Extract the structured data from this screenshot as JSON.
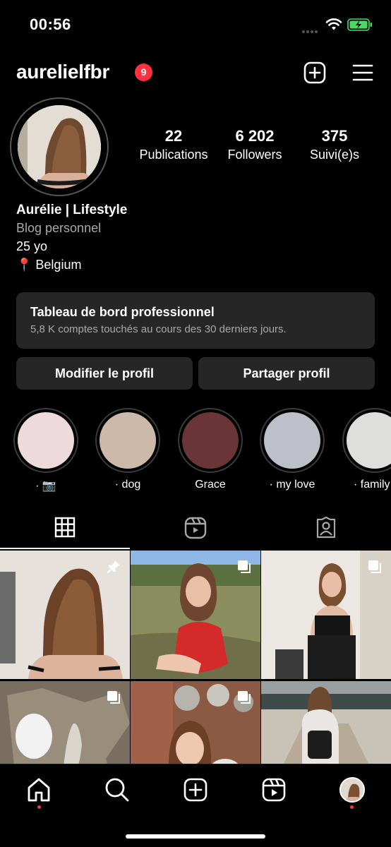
{
  "status_bar": {
    "time": "00:56"
  },
  "header": {
    "username": "aurelielfbr",
    "notification_count": "9",
    "icons": [
      "new-post-icon",
      "menu-icon"
    ]
  },
  "profile": {
    "stats": [
      {
        "value": "22",
        "label": "Publications"
      },
      {
        "value": "6 202",
        "label": "Followers"
      },
      {
        "value": "375",
        "label": "Suivi(e)s"
      }
    ],
    "name": "Aurélie | Lifestyle",
    "category": "Blog personnel",
    "bio_lines": [
      "25 yo",
      "📍 Belgium"
    ]
  },
  "dashboard": {
    "title": "Tableau de bord professionnel",
    "subtitle": "5,8 K comptes touchés au cours des 30 derniers jours."
  },
  "buttons": {
    "edit": "Modifier le profil",
    "share": "Partager profil"
  },
  "highlights": [
    {
      "label": "· 📷",
      "color": "#eedadd"
    },
    {
      "label": "· dog",
      "color": "#cdb9a9"
    },
    {
      "label": "Grace",
      "color": "#6a3537"
    },
    {
      "label": "· my love",
      "color": "#bdc0c8"
    },
    {
      "label": "· family",
      "color": "#dedfdc"
    }
  ],
  "tabs": [
    "grid-icon",
    "reels-icon",
    "tagged-icon"
  ],
  "grid_posts": [
    {
      "type": "pinned-icon"
    },
    {
      "type": "carousel-icon"
    },
    {
      "type": "carousel-icon"
    },
    {
      "type": "carousel-icon"
    },
    {
      "type": "carousel-icon"
    },
    {
      "type": "none"
    }
  ],
  "colors": {
    "accent_red": "#ff3040",
    "card_bg": "#262626",
    "secondary_text": "#a8a8a8",
    "battery_green": "#4cd964"
  },
  "bottom_nav": [
    "home-icon",
    "search-icon",
    "create-icon",
    "reels-icon",
    "profile-avatar"
  ]
}
